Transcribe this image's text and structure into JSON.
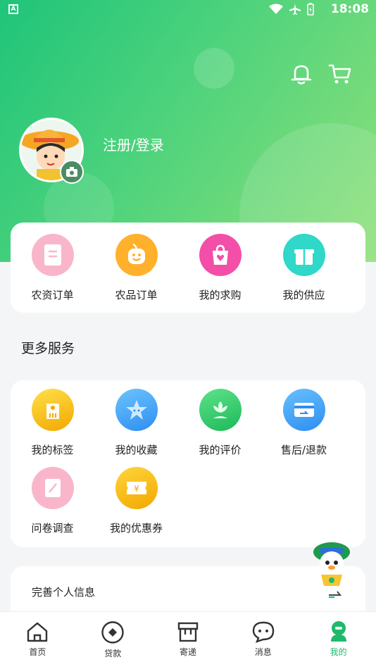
{
  "status_bar": {
    "time": "18:08",
    "badge": "A"
  },
  "header": {
    "bell_icon": "bell-icon",
    "cart_icon": "cart-icon"
  },
  "profile": {
    "login_label": "注册/登录"
  },
  "orders": [
    {
      "label": "农资订单",
      "icon": "document-icon",
      "color": "#f9b6cb"
    },
    {
      "label": "农品订单",
      "icon": "fruit-face-icon",
      "color": "#ffb12c"
    },
    {
      "label": "我的求购",
      "icon": "shopping-bag-heart-icon",
      "color": "#f34fa8"
    },
    {
      "label": "我的供应",
      "icon": "gift-box-icon",
      "color": "#2fd8c8"
    }
  ],
  "more_services": {
    "title": "更多服务",
    "items": [
      {
        "label": "我的标签",
        "icon": "tag-icon",
        "color": "#ffc21a"
      },
      {
        "label": "我的收藏",
        "icon": "star-icon",
        "color": "#3da6f5"
      },
      {
        "label": "我的评价",
        "icon": "flower-icon",
        "color": "#2ccf6c"
      },
      {
        "label": "售后/退款",
        "icon": "refund-card-icon",
        "color": "#3aa5f0"
      },
      {
        "label": "问卷调查",
        "icon": "survey-icon",
        "color": "#f9b6cb"
      },
      {
        "label": "我的优惠券",
        "icon": "coupon-icon",
        "color": "#ffc21a"
      }
    ]
  },
  "profile_info": {
    "title": "完善个人信息"
  },
  "tabs": [
    {
      "label": "首页",
      "icon": "home-icon",
      "active": false
    },
    {
      "label": "贷款",
      "icon": "loan-icon",
      "active": false
    },
    {
      "label": "寄递",
      "icon": "delivery-box-icon",
      "active": false
    },
    {
      "label": "消息",
      "icon": "message-icon",
      "active": false
    },
    {
      "label": "我的",
      "icon": "profile-icon",
      "active": true
    }
  ],
  "colors": {
    "brand_green": "#1fb96b",
    "hero_start": "#1fc47a",
    "hero_end": "#8fe07a"
  }
}
